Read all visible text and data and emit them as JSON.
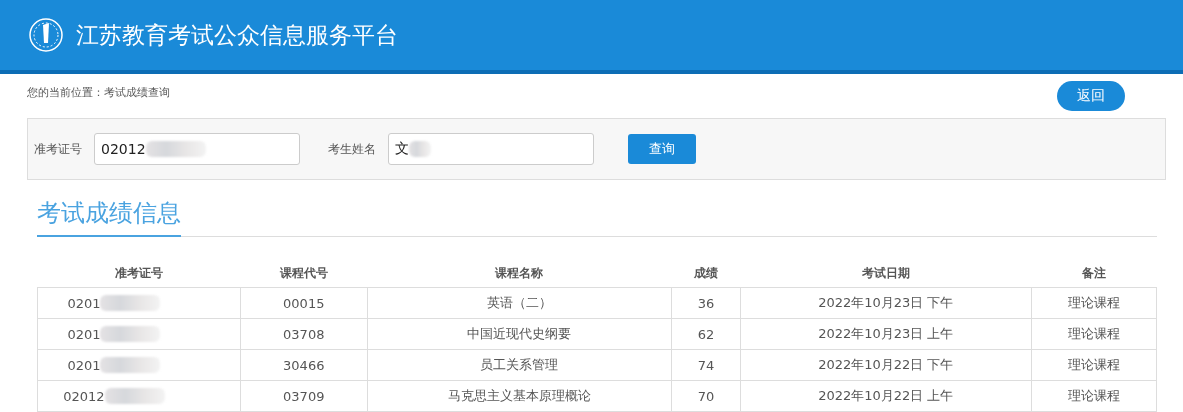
{
  "header": {
    "title": "江苏教育考试公众信息服务平台"
  },
  "breadcrumb": "您的当前位置：考试成绩查询",
  "back_button": "返回",
  "search": {
    "fields": [
      {
        "label": "准考证号",
        "value": "02012"
      },
      {
        "label": "考生姓名",
        "value": "文"
      }
    ],
    "button": "查询"
  },
  "section_title": "考试成绩信息",
  "table": {
    "columns": [
      "准考证号",
      "课程代号",
      "课程名称",
      "成绩",
      "考试日期",
      "备注"
    ],
    "rows": [
      [
        "0201",
        "00015",
        "英语（二）",
        "36",
        "2022年10月23日 下午",
        "理论课程"
      ],
      [
        "0201",
        "03708",
        "中国近现代史纲要",
        "62",
        "2022年10月23日 上午",
        "理论课程"
      ],
      [
        "0201",
        "30466",
        "员工关系管理",
        "74",
        "2022年10月22日 下午",
        "理论课程"
      ],
      [
        "02012",
        "03709",
        "马克思主义基本原理概论",
        "70",
        "2022年10月22日 上午",
        "理论课程"
      ]
    ]
  }
}
